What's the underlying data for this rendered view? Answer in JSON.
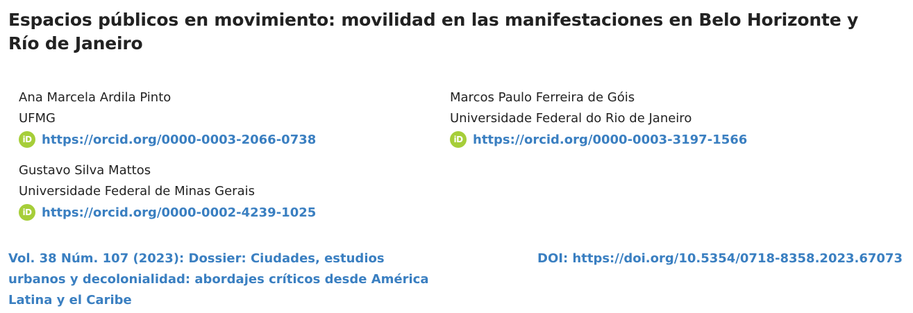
{
  "article": {
    "title": "Espacios públicos en movimiento: movilidad en las manifestaciones en Belo Horizonte y Río de Janeiro"
  },
  "authors": [
    {
      "name": "Ana Marcela Ardila Pinto",
      "affiliation": "UFMG",
      "orcid": "https://orcid.org/0000-0003-2066-0738"
    },
    {
      "name": "Marcos Paulo Ferreira de Góis",
      "affiliation": "Universidade Federal do Rio de Janeiro",
      "orcid": "https://orcid.org/0000-0003-3197-1566"
    },
    {
      "name": "Gustavo Silva Mattos",
      "affiliation": "Universidade Federal de Minas Gerais",
      "orcid": "https://orcid.org/0000-0002-4239-1025"
    }
  ],
  "orcid_icon": {
    "label": "iD",
    "icon": "orcid-icon",
    "color": "#a6ce39"
  },
  "issue": {
    "label": "Vol. 38 Núm. 107 (2023): Dossier: Ciudades, estudios urbanos y decolonialidad: abordajes críticos desde América Latina y el Caribe"
  },
  "doi": {
    "label": "DOI:",
    "url": "https://doi.org/10.5354/0718-8358.2023.67073"
  },
  "colors": {
    "link": "#3a7fc1",
    "text": "#222222"
  }
}
